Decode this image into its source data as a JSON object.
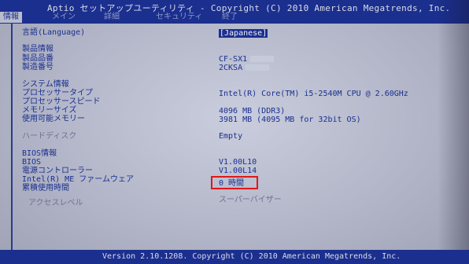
{
  "header": {
    "title": "Aptio セットアップユーティリティ - Copyright (C) 2010 American Megatrends, Inc.",
    "tabs": [
      "情報",
      "メイン",
      "詳細",
      "セキュリティ",
      "終了"
    ]
  },
  "language": {
    "label": "言語(Language)",
    "value": "[Japanese]"
  },
  "product": {
    "heading": "製品情報",
    "model_label": "製品品番",
    "model_value": "CF-SX1",
    "serial_label": "製造番号",
    "serial_value": "2CKSA"
  },
  "system": {
    "heading": "システム情報",
    "processor_type_label": "プロセッサータイプ",
    "processor_type_value": "Intel(R) Core(TM) i5-2540M CPU @ 2.60GHz",
    "processor_speed_label": "プロセッサースピード",
    "memory_size_label": "メモリーサイズ",
    "memory_size_value": "4096 MB (DDR3)",
    "usable_memory_label": "使用可能メモリー",
    "usable_memory_value": "3981 MB (4095 MB for 32bit OS)"
  },
  "hdd": {
    "label": "ハードディスク",
    "value": "Empty"
  },
  "bios": {
    "heading": "BIOS情報",
    "bios_label": "BIOS",
    "bios_value": "V1.00L10",
    "ec_label": "電源コントローラー",
    "ec_value": "V1.00L14",
    "me_label": "Intel(R) ME ファームウェア",
    "usage_label": "累積使用時間",
    "usage_value": "0 時間"
  },
  "access": {
    "label": "アクセスレベル",
    "value": "スーパーバイザー"
  },
  "footer": {
    "text": "Version 2.10.1208. Copyright (C) 2010 American Megatrends, Inc."
  },
  "colors": {
    "accent": "#1b2f8f",
    "highlight": "#e01818",
    "background": "#b2b6c8"
  }
}
